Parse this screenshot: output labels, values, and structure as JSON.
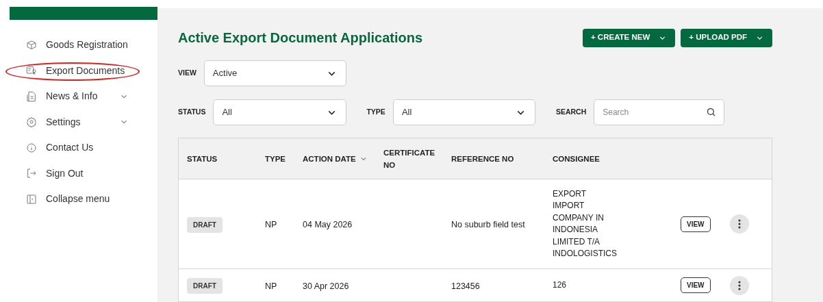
{
  "sidebar": {
    "items": [
      {
        "kind": "box",
        "label": "Goods Registration",
        "expandable": false,
        "circled": false
      },
      {
        "kind": "doc",
        "label": "Export Documents",
        "expandable": false,
        "circled": true
      },
      {
        "kind": "news",
        "label": "News & Info",
        "expandable": true,
        "circled": false
      },
      {
        "kind": "gear",
        "label": "Settings",
        "expandable": true,
        "circled": false
      },
      {
        "kind": "info",
        "label": "Contact Us",
        "expandable": false,
        "circled": false
      },
      {
        "kind": "signout",
        "label": "Sign Out",
        "expandable": false,
        "circled": false
      },
      {
        "kind": "collapse",
        "label": "Collapse menu",
        "expandable": false,
        "circled": false
      }
    ]
  },
  "page": {
    "title": "Active Export Document Applications",
    "buttons": [
      "+ CREATE NEW",
      "+ UPLOAD PDF"
    ],
    "view": {
      "label": "VIEW",
      "value": "Active"
    },
    "filters": [
      {
        "kind": "select",
        "label": "STATUS",
        "value": "All"
      },
      {
        "kind": "select",
        "label": "TYPE",
        "value": "All"
      },
      {
        "kind": "search",
        "label": "SEARCH",
        "placeholder": "Search"
      }
    ]
  },
  "table": {
    "columns": [
      {
        "label": "STATUS",
        "sortable": false
      },
      {
        "label": "TYPE",
        "sortable": false
      },
      {
        "label": "ACTION DATE",
        "sortable": true
      },
      {
        "label": "CERTIFICATE NO",
        "sortable": false
      },
      {
        "label": "REFERENCE NO",
        "sortable": false
      },
      {
        "label": "CONSIGNEE",
        "sortable": false
      }
    ],
    "rows": [
      {
        "status": "DRAFT",
        "type": "NP",
        "action_date": "04 May 2026",
        "certificate_no": "",
        "reference_no": "No suburb field test",
        "consignee": [
          "EXPORT",
          "IMPORT",
          "COMPANY IN",
          "INDONESIA",
          "LIMITED T/A",
          "INDOLOGISTICS"
        ],
        "action": "VIEW"
      },
      {
        "status": "DRAFT",
        "type": "NP",
        "action_date": "30 Apr 2026",
        "certificate_no": "",
        "reference_no": "123456",
        "consignee": [
          "126"
        ],
        "action": "VIEW"
      }
    ]
  }
}
